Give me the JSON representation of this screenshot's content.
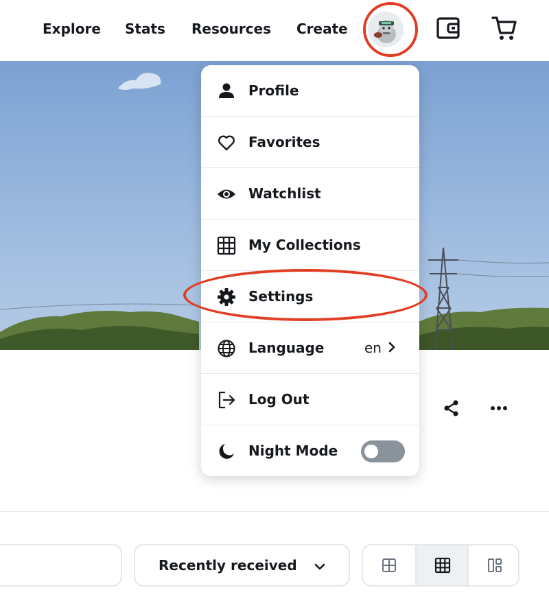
{
  "nav": {
    "links": [
      "Explore",
      "Stats",
      "Resources",
      "Create"
    ]
  },
  "menu": {
    "items": [
      {
        "label": "Profile",
        "icon": "person-icon"
      },
      {
        "label": "Favorites",
        "icon": "heart-icon"
      },
      {
        "label": "Watchlist",
        "icon": "eye-icon"
      },
      {
        "label": "My Collections",
        "icon": "grid-icon"
      },
      {
        "label": "Settings",
        "icon": "gear-icon"
      },
      {
        "label": "Language",
        "icon": "globe-icon",
        "value": "en"
      },
      {
        "label": "Log Out",
        "icon": "logout-icon"
      },
      {
        "label": "Night Mode",
        "icon": "moon-icon",
        "toggle": false
      }
    ]
  },
  "sort": {
    "selected": "Recently received"
  },
  "colors": {
    "highlight": "#e23c22",
    "text": "#15181d",
    "border": "#e5e8eb"
  }
}
